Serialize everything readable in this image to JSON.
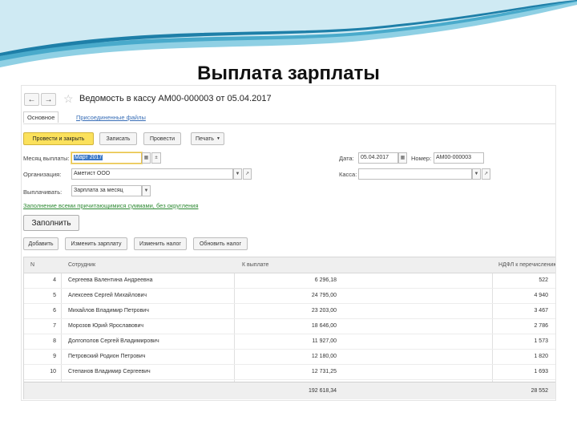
{
  "slide": {
    "title": "Выплата зарплаты"
  },
  "window": {
    "title": "Ведомость в кассу АМ00-000003 от 05.04.2017"
  },
  "tabs": {
    "main": "Основное",
    "files": "Присоединенные файлы"
  },
  "toolbar": {
    "post_close": "Провести и закрыть",
    "save": "Записать",
    "post": "Провести",
    "print": "Печать"
  },
  "form": {
    "month_label": "Месяц выплаты:",
    "month_value": "Март 2017",
    "org_label": "Организация:",
    "org_value": "Аметист ООО",
    "pay_label": "Выплачивать:",
    "pay_value": "Зарплата за месяц",
    "date_label": "Дата:",
    "date_value": "05.04.2017",
    "number_label": "Номер:",
    "number_value": "АМ00-000003",
    "cash_label": "Касса:",
    "cash_value": ""
  },
  "fill_link": "Заполнение всеми причитающимися суммами, без округления",
  "fill_button": "Заполнить",
  "table_toolbar": {
    "add": "Добавить",
    "edit_salary": "Изменить зарплату",
    "edit_tax": "Изменить налог",
    "update_tax": "Обновить налог"
  },
  "table": {
    "columns": [
      "N",
      "Сотрудник",
      "К выплате",
      "НДФЛ к перечислению"
    ],
    "rows": [
      {
        "n": "4",
        "employee": "Сергеева Валентина Андреевна",
        "pay": "6 296,18",
        "tax": "522"
      },
      {
        "n": "5",
        "employee": "Алексеев Сергей Михайлович",
        "pay": "24 795,00",
        "tax": "4 940"
      },
      {
        "n": "6",
        "employee": "Михайлов Владимир Петрович",
        "pay": "23 203,00",
        "tax": "3 467"
      },
      {
        "n": "7",
        "employee": "Морозов Юрий Ярославович",
        "pay": "18 646,00",
        "tax": "2 786"
      },
      {
        "n": "8",
        "employee": "Долгополов Сергей Владимирович",
        "pay": "11 927,00",
        "tax": "1 573"
      },
      {
        "n": "9",
        "employee": "Петровский Родион Петрович",
        "pay": "12 180,00",
        "tax": "1 820"
      },
      {
        "n": "10",
        "employee": "Степанов Владимир Сергеевич",
        "pay": "12 731,25",
        "tax": "1 693"
      }
    ],
    "totals": {
      "pay": "192 618,34",
      "tax": "28 552"
    }
  }
}
